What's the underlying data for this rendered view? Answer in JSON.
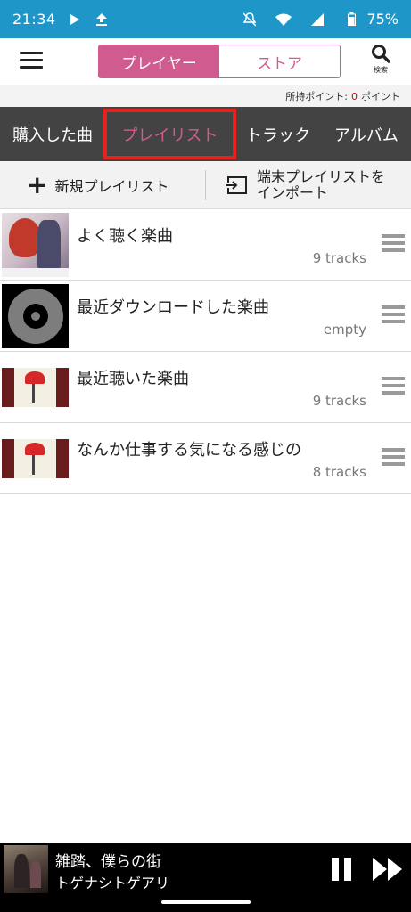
{
  "status_bar": {
    "time": "21:34",
    "battery": "75%",
    "icons": [
      "play-icon",
      "upload-icon",
      "bell-off-icon",
      "wifi-icon",
      "signal-icon",
      "battery-icon"
    ],
    "bg_color": "#1e96c8"
  },
  "header": {
    "segments": [
      {
        "label": "プレイヤー",
        "active": true
      },
      {
        "label": "ストア",
        "active": false
      }
    ],
    "search_label": "検索",
    "accent_color": "#d05c8f"
  },
  "points": {
    "label": "所持ポイント:",
    "value": "0",
    "unit": "ポイント"
  },
  "tabs": [
    {
      "label": "購入した曲",
      "active": false
    },
    {
      "label": "プレイリスト",
      "active": true
    },
    {
      "label": "トラック",
      "active": false
    },
    {
      "label": "アルバム",
      "active": false
    }
  ],
  "actions": {
    "new_playlist": "新規プレイリスト",
    "import_line1": "端末プレイリストを",
    "import_line2": "インポート"
  },
  "playlists": [
    {
      "title": "よく聴く楽曲",
      "count": "9 tracks"
    },
    {
      "title": "最近ダウンロードした楽曲",
      "count": "empty"
    },
    {
      "title": "最近聴いた楽曲",
      "count": "9 tracks"
    },
    {
      "title": "なんか仕事する気になる感じの",
      "count": "8 tracks"
    }
  ],
  "now_playing": {
    "title": "雑踏、僕らの街",
    "artist": "トゲナシトゲアリ"
  }
}
